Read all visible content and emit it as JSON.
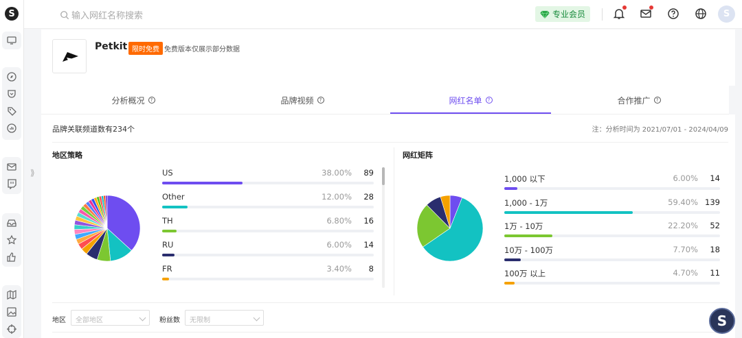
{
  "header": {
    "search_placeholder": "输入网红名称搜索",
    "vip_label": "专业会员",
    "avatar_letter": "S"
  },
  "brand": {
    "name": "Petkit",
    "tag": "限时免费",
    "note": "免费版本仅展示部分数据"
  },
  "tabs": [
    {
      "label": "分析概况"
    },
    {
      "label": "品牌视频"
    },
    {
      "label": "网红名单"
    },
    {
      "label": "合作推广"
    }
  ],
  "active_tab": 2,
  "summary": {
    "count_text": "品牌关联频道数有234个",
    "period_text": "注：分析时间为 2021/07/01 - 2024/04/09"
  },
  "region": {
    "title": "地区策略",
    "rows": [
      {
        "label": "US",
        "pct": "38.00%",
        "value": 38.0,
        "num": "89",
        "color": "#6e4df0"
      },
      {
        "label": "Other",
        "pct": "12.00%",
        "value": 12.0,
        "num": "28",
        "color": "#13c2c2"
      },
      {
        "label": "TH",
        "pct": "6.80%",
        "value": 6.8,
        "num": "16",
        "color": "#7cc731"
      },
      {
        "label": "RU",
        "pct": "6.00%",
        "value": 6.0,
        "num": "14",
        "color": "#2a2d6e"
      },
      {
        "label": "FR",
        "pct": "3.40%",
        "value": 3.4,
        "num": "8",
        "color": "#f5a100"
      }
    ],
    "pie_extra": [
      {
        "value": 3.0,
        "color": "#ff4d4f"
      },
      {
        "value": 2.6,
        "color": "#ffa940"
      },
      {
        "value": 2.6,
        "color": "#40a9ff"
      },
      {
        "value": 2.5,
        "color": "#ff85c0"
      },
      {
        "value": 2.4,
        "color": "#36cfc9"
      },
      {
        "value": 2.3,
        "color": "#9254de"
      },
      {
        "value": 2.2,
        "color": "#ffc53d"
      },
      {
        "value": 2.1,
        "color": "#5cdbd3"
      },
      {
        "value": 2.0,
        "color": "#f759ab"
      },
      {
        "value": 1.9,
        "color": "#73d13d"
      },
      {
        "value": 1.8,
        "color": "#ff7a45"
      },
      {
        "value": 1.7,
        "color": "#597ef7"
      },
      {
        "value": 1.6,
        "color": "#eb2f96"
      },
      {
        "value": 1.5,
        "color": "#2f54eb"
      },
      {
        "value": 1.4,
        "color": "#faad14"
      },
      {
        "value": 1.3,
        "color": "#52c41a"
      },
      {
        "value": 1.2,
        "color": "#ff4d4f"
      },
      {
        "value": 1.1,
        "color": "#13c2c2"
      },
      {
        "value": 1.0,
        "color": "#fa541c"
      },
      {
        "value": 0.9,
        "color": "#722ed1"
      }
    ]
  },
  "influencer": {
    "title": "网红矩阵",
    "rows": [
      {
        "label": "1,000 以下",
        "pct": "6.00%",
        "value": 6.0,
        "num": "14",
        "color": "#6e4df0"
      },
      {
        "label": "1,000 - 1万",
        "pct": "59.40%",
        "value": 59.4,
        "num": "139",
        "color": "#13c2c2"
      },
      {
        "label": "1万 - 10万",
        "pct": "22.20%",
        "value": 22.2,
        "num": "52",
        "color": "#7cc731"
      },
      {
        "label": "10万 - 100万",
        "pct": "7.70%",
        "value": 7.7,
        "num": "18",
        "color": "#2a2d6e"
      },
      {
        "label": "100万 以上",
        "pct": "4.70%",
        "value": 4.7,
        "num": "11",
        "color": "#f5a100"
      }
    ]
  },
  "filters": {
    "region_label": "地区",
    "region_value": "全部地区",
    "fans_label": "粉丝数",
    "fans_value": "无限制"
  },
  "float_button": "S"
}
